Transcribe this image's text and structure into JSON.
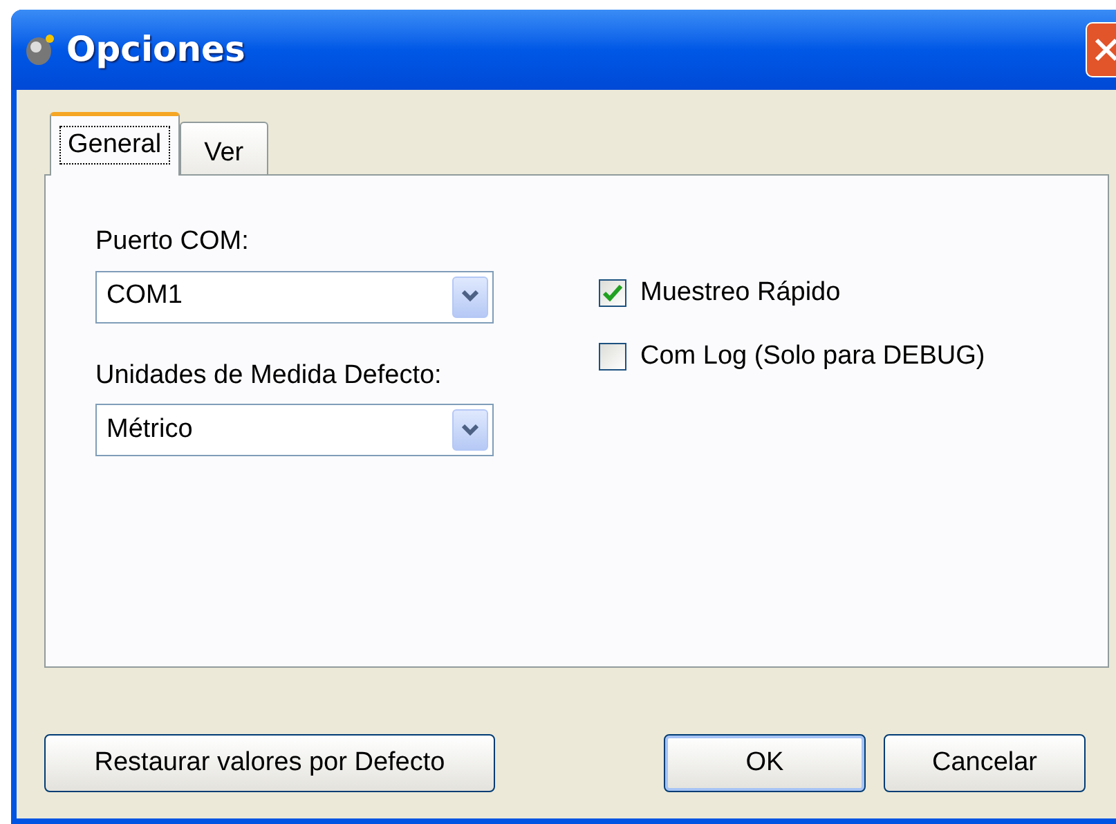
{
  "window": {
    "title": "Opciones"
  },
  "tabs": [
    {
      "label": "General",
      "selected": true
    },
    {
      "label": "Ver",
      "selected": false
    }
  ],
  "fields": [
    {
      "label": "Puerto COM:",
      "value": "COM1"
    },
    {
      "label": "Unidades de Medida Defecto:",
      "value": "Métrico"
    }
  ],
  "checkboxes": [
    {
      "label": "Muestreo Rápido",
      "checked": true
    },
    {
      "label": "Com Log (Solo para DEBUG)",
      "checked": false
    }
  ],
  "buttons": [
    {
      "label": "Restaurar valores por Defecto",
      "kind": "left"
    },
    {
      "label": "OK",
      "kind": "default"
    },
    {
      "label": "Cancelar",
      "kind": "normal"
    }
  ]
}
